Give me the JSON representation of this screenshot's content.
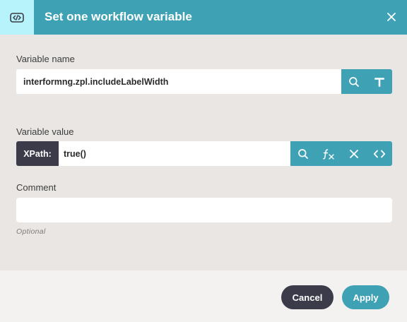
{
  "header": {
    "title": "Set one workflow variable",
    "icon": "workflow-variable-icon",
    "close_icon": "close-icon",
    "colors": {
      "bar": "#3fa1b4",
      "icon_box": "#b6f3fa"
    }
  },
  "variable_name": {
    "label": "Variable name",
    "value": "interformng.zpl.includeLabelWidth",
    "buttons": [
      "search-icon",
      "text-type-icon"
    ]
  },
  "variable_value": {
    "label": "Variable value",
    "mode_label": "XPath:",
    "value": "true()",
    "buttons": [
      "search-icon",
      "function-icon",
      "clear-icon",
      "code-icon"
    ]
  },
  "comment": {
    "label": "Comment",
    "value": "",
    "hint": "Optional"
  },
  "footer": {
    "cancel_label": "Cancel",
    "apply_label": "Apply",
    "colors": {
      "cancel": "#3b3b4a",
      "apply": "#3fa1b4"
    }
  }
}
